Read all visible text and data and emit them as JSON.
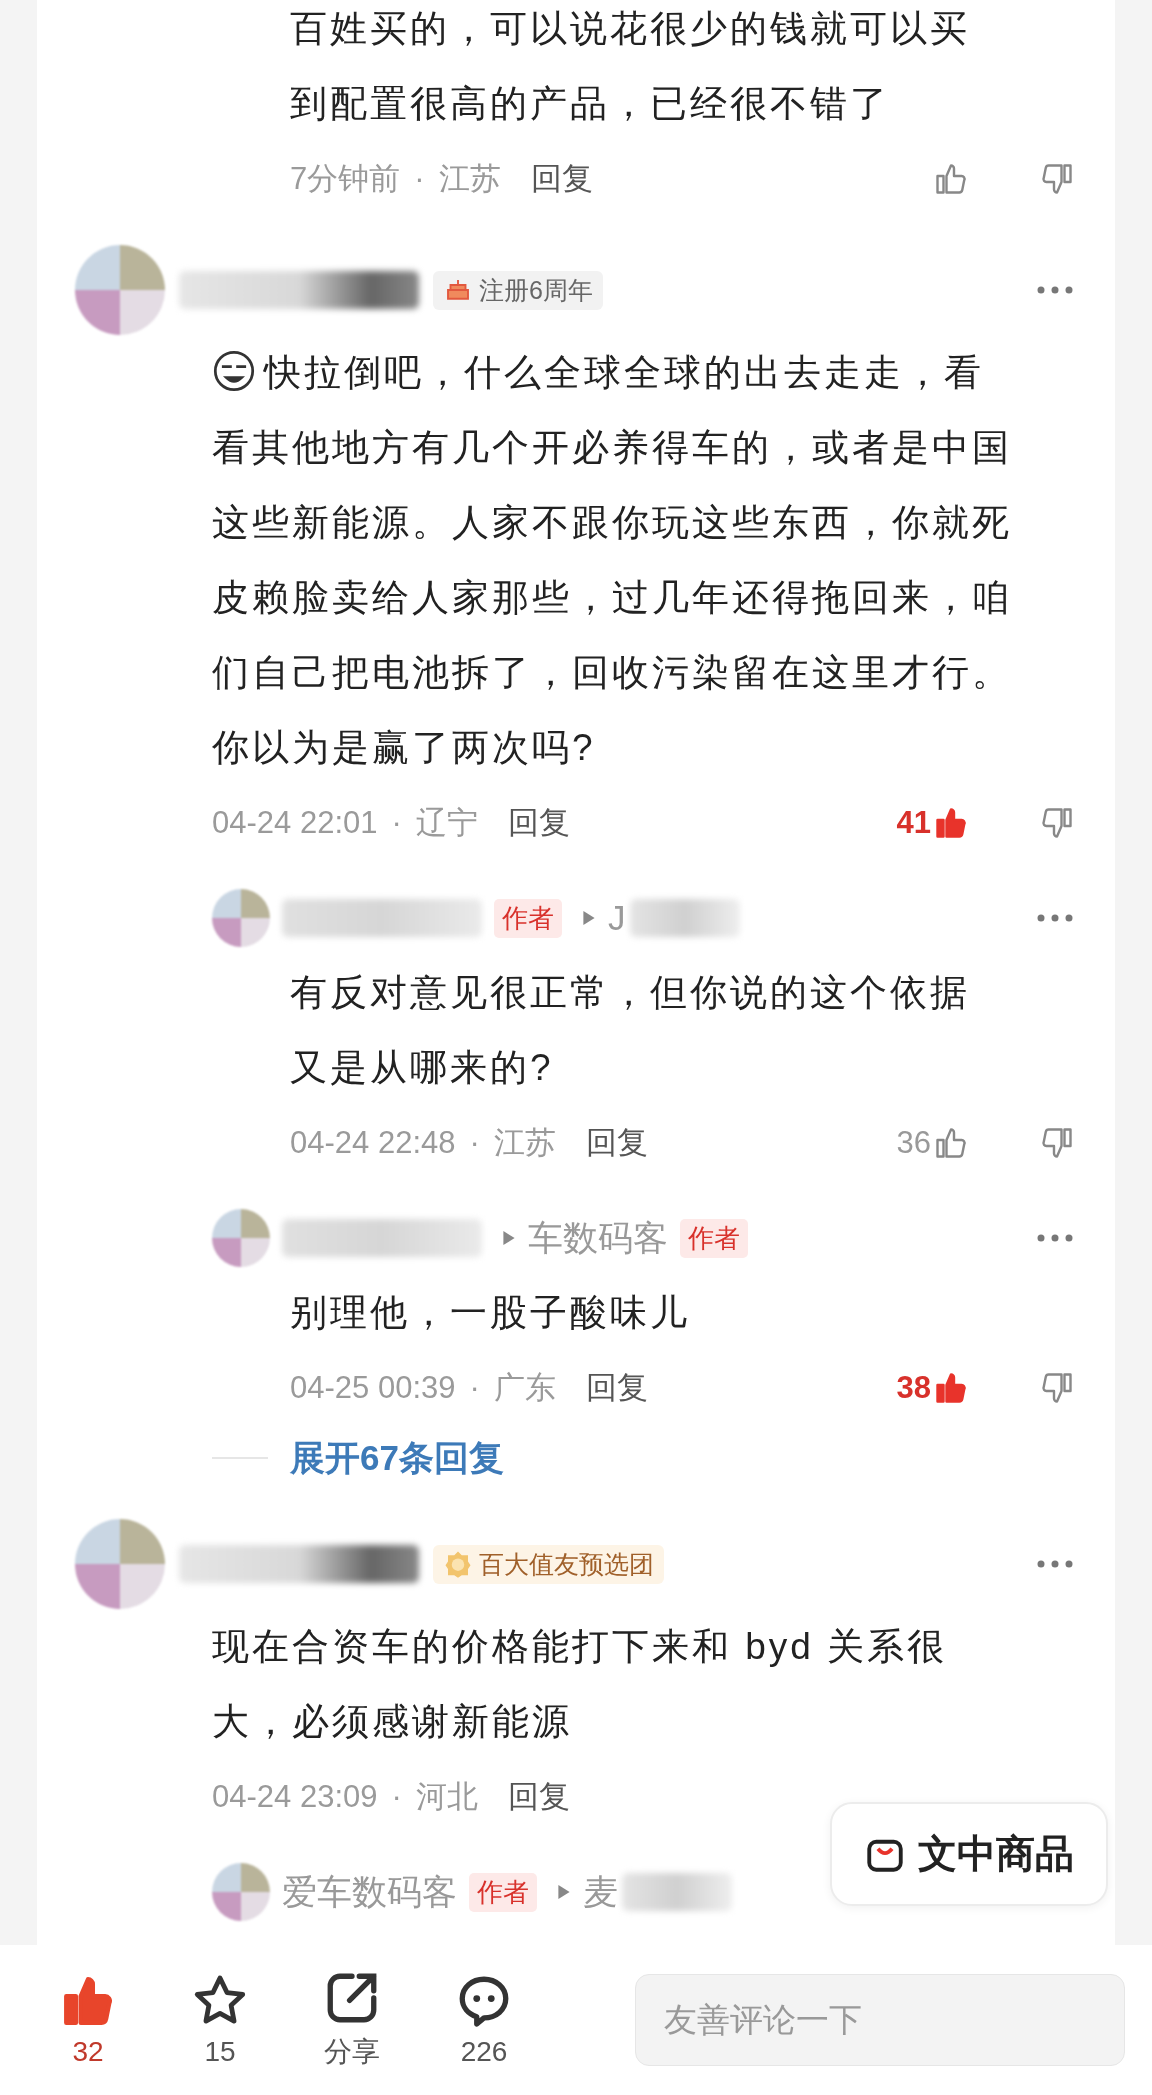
{
  "items": [
    {
      "kind": "reply",
      "text": "百姓买的，可以说花很少的钱就可以买到配置很高的产品，已经很不错了",
      "time": "7分钟前",
      "sep": "·",
      "region": "江苏",
      "reply": "回复",
      "liked": false
    },
    {
      "kind": "comment",
      "badge": {
        "kind": "anniversary",
        "text": "注册6周年"
      },
      "emoji": true,
      "text": "快拉倒吧，什么全球全球的出去走走，看看其他地方有几个开必养得车的，或者是中国这些新能源。人家不跟你玩这些东西，你就死皮赖脸卖给人家那些，过几年还得拖回来，咱们自己把电池拆了，回收污染留在这里才行。你以为是赢了两次吗?",
      "time": "04-24 22:01",
      "sep": "·",
      "region": "辽宁",
      "reply": "回复",
      "likes": "41",
      "liked": true
    },
    {
      "kind": "reply",
      "author_tag": "作者",
      "target": "J",
      "text": "有反对意见很正常，但你说的这个依据又是从哪来的?",
      "time": "04-24 22:48",
      "sep": "·",
      "region": "江苏",
      "reply": "回复",
      "likes": "36",
      "liked": false
    },
    {
      "kind": "reply",
      "target": "车数码客",
      "target_tag": "作者",
      "text": "别理他，一股子酸味儿",
      "time": "04-25 00:39",
      "sep": "·",
      "region": "广东",
      "reply": "回复",
      "likes": "38",
      "liked": true
    },
    {
      "kind": "expand",
      "text": "展开67条回复"
    },
    {
      "kind": "comment",
      "badge": {
        "kind": "medal",
        "text": "百大值友预选团"
      },
      "emoji": false,
      "text": "现在合资车的价格能打下来和 byd 关系很大，必须感谢新能源",
      "time": "04-24 23:09",
      "sep": "·",
      "region": "河北",
      "reply": "回复"
    },
    {
      "kind": "reply",
      "author": "爱车数码客",
      "author_tag": "作者",
      "target": "麦"
    }
  ],
  "floating_button": {
    "label": "文中商品"
  },
  "bottom_bar": {
    "actions": [
      {
        "kind": "like",
        "label": "32",
        "selected": true
      },
      {
        "kind": "star",
        "label": "15",
        "selected": false
      },
      {
        "kind": "share",
        "label": "分享",
        "selected": false
      },
      {
        "kind": "comment",
        "label": "226",
        "selected": false
      }
    ],
    "input": {
      "placeholder": "友善评论一下"
    }
  }
}
